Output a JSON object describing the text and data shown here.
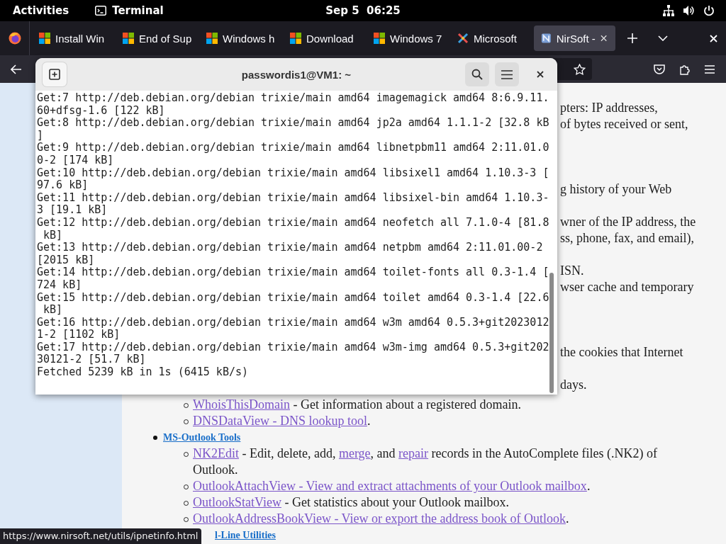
{
  "top_bar": {
    "activities": "Activities",
    "app": "Terminal",
    "clock": "Sep 5  06:25"
  },
  "browser": {
    "tabs": [
      {
        "title": "Install Win",
        "kind": "windows",
        "selected": false
      },
      {
        "title": "End of Sup",
        "kind": "windows",
        "selected": false
      },
      {
        "title": "Windows h",
        "kind": "windows",
        "selected": false
      },
      {
        "title": "Download",
        "kind": "windows",
        "selected": false
      },
      {
        "title": "Windows 7",
        "kind": "windows",
        "selected": false
      },
      {
        "title": "Microsoft",
        "kind": "tools",
        "selected": false
      },
      {
        "title": "NirSoft -",
        "kind": "nirsoft",
        "selected": true
      }
    ]
  },
  "page": {
    "fragments": [
      [
        "pters: IP addresses,",
        "of bytes received or sent,"
      ],
      [
        "g history of your Web"
      ],
      [
        "wner of the IP address, the",
        "ss, phone, fax, and email),"
      ],
      [
        "ISN.",
        "wser cache and temporary"
      ],
      [
        "the cookies that Internet"
      ],
      [
        "days."
      ]
    ],
    "items": [
      {
        "kind": "sub",
        "parts": [
          {
            "text": "WhoisThisDomain",
            "link": true
          },
          {
            "text": " - Get information about a registered domain.",
            "link": false
          }
        ]
      },
      {
        "kind": "sub",
        "parts": [
          {
            "text": "DNSDataView - DNS lookup tool",
            "link": true
          },
          {
            "text": ".",
            "link": false
          }
        ]
      },
      {
        "kind": "section",
        "parts": [
          {
            "text": "MS-Outlook Tools",
            "link": true
          }
        ]
      },
      {
        "kind": "sub",
        "parts": [
          {
            "text": "NK2Edit",
            "link": true
          },
          {
            "text": " - Edit, delete, add, ",
            "link": false
          },
          {
            "text": "merge",
            "link": true
          },
          {
            "text": ", and ",
            "link": false
          },
          {
            "text": "repair",
            "link": true
          },
          {
            "text": " records in the AutoComplete files (.NK2) of Outlook.",
            "link": false
          }
        ]
      },
      {
        "kind": "sub",
        "parts": [
          {
            "text": "OutlookAttachView - View and extract attachments of your Outlook mailbox",
            "link": true
          },
          {
            "text": ".",
            "link": false
          }
        ]
      },
      {
        "kind": "sub",
        "parts": [
          {
            "text": "OutlookStatView",
            "link": true
          },
          {
            "text": " - Get statistics about your Outlook mailbox.",
            "link": false
          }
        ]
      },
      {
        "kind": "sub",
        "parts": [
          {
            "text": "OutlookAddressBookView - View or export the address book of Outlook",
            "link": true
          },
          {
            "text": ".",
            "link": false
          }
        ]
      },
      {
        "kind": "cut",
        "parts": [
          {
            "text": "l-Line Utilities",
            "link": true
          }
        ]
      }
    ],
    "status_url": "https://www.nirsoft.net/utils/ipnetinfo.html"
  },
  "terminal": {
    "title": "passwordis1@VM1: ~",
    "lines": [
      "Get:7 http://deb.debian.org/debian trixie/main amd64 imagemagick amd64 8:6.9.11.",
      "60+dfsg-1.6 [122 kB]",
      "Get:8 http://deb.debian.org/debian trixie/main amd64 jp2a amd64 1.1.1-2 [32.8 kB",
      "]",
      "Get:9 http://deb.debian.org/debian trixie/main amd64 libnetpbm11 amd64 2:11.01.0",
      "0-2 [174 kB]",
      "Get:10 http://deb.debian.org/debian trixie/main amd64 libsixel1 amd64 1.10.3-3 [",
      "97.6 kB]",
      "Get:11 http://deb.debian.org/debian trixie/main amd64 libsixel-bin amd64 1.10.3-",
      "3 [19.1 kB]",
      "Get:12 http://deb.debian.org/debian trixie/main amd64 neofetch all 7.1.0-4 [81.8",
      " kB]",
      "Get:13 http://deb.debian.org/debian trixie/main amd64 netpbm amd64 2:11.01.00-2",
      "[2015 kB]",
      "Get:14 http://deb.debian.org/debian trixie/main amd64 toilet-fonts all 0.3-1.4 [",
      "724 kB]",
      "Get:15 http://deb.debian.org/debian trixie/main amd64 toilet amd64 0.3-1.4 [22.6",
      " kB]",
      "Get:16 http://deb.debian.org/debian trixie/main amd64 w3m amd64 0.5.3+git2023012",
      "1-2 [1102 kB]",
      "Get:17 http://deb.debian.org/debian trixie/main amd64 w3m-img amd64 0.5.3+git202",
      "30121-2 [51.7 kB]",
      "Fetched 5239 kB in 1s (6415 kB/s)"
    ]
  }
}
